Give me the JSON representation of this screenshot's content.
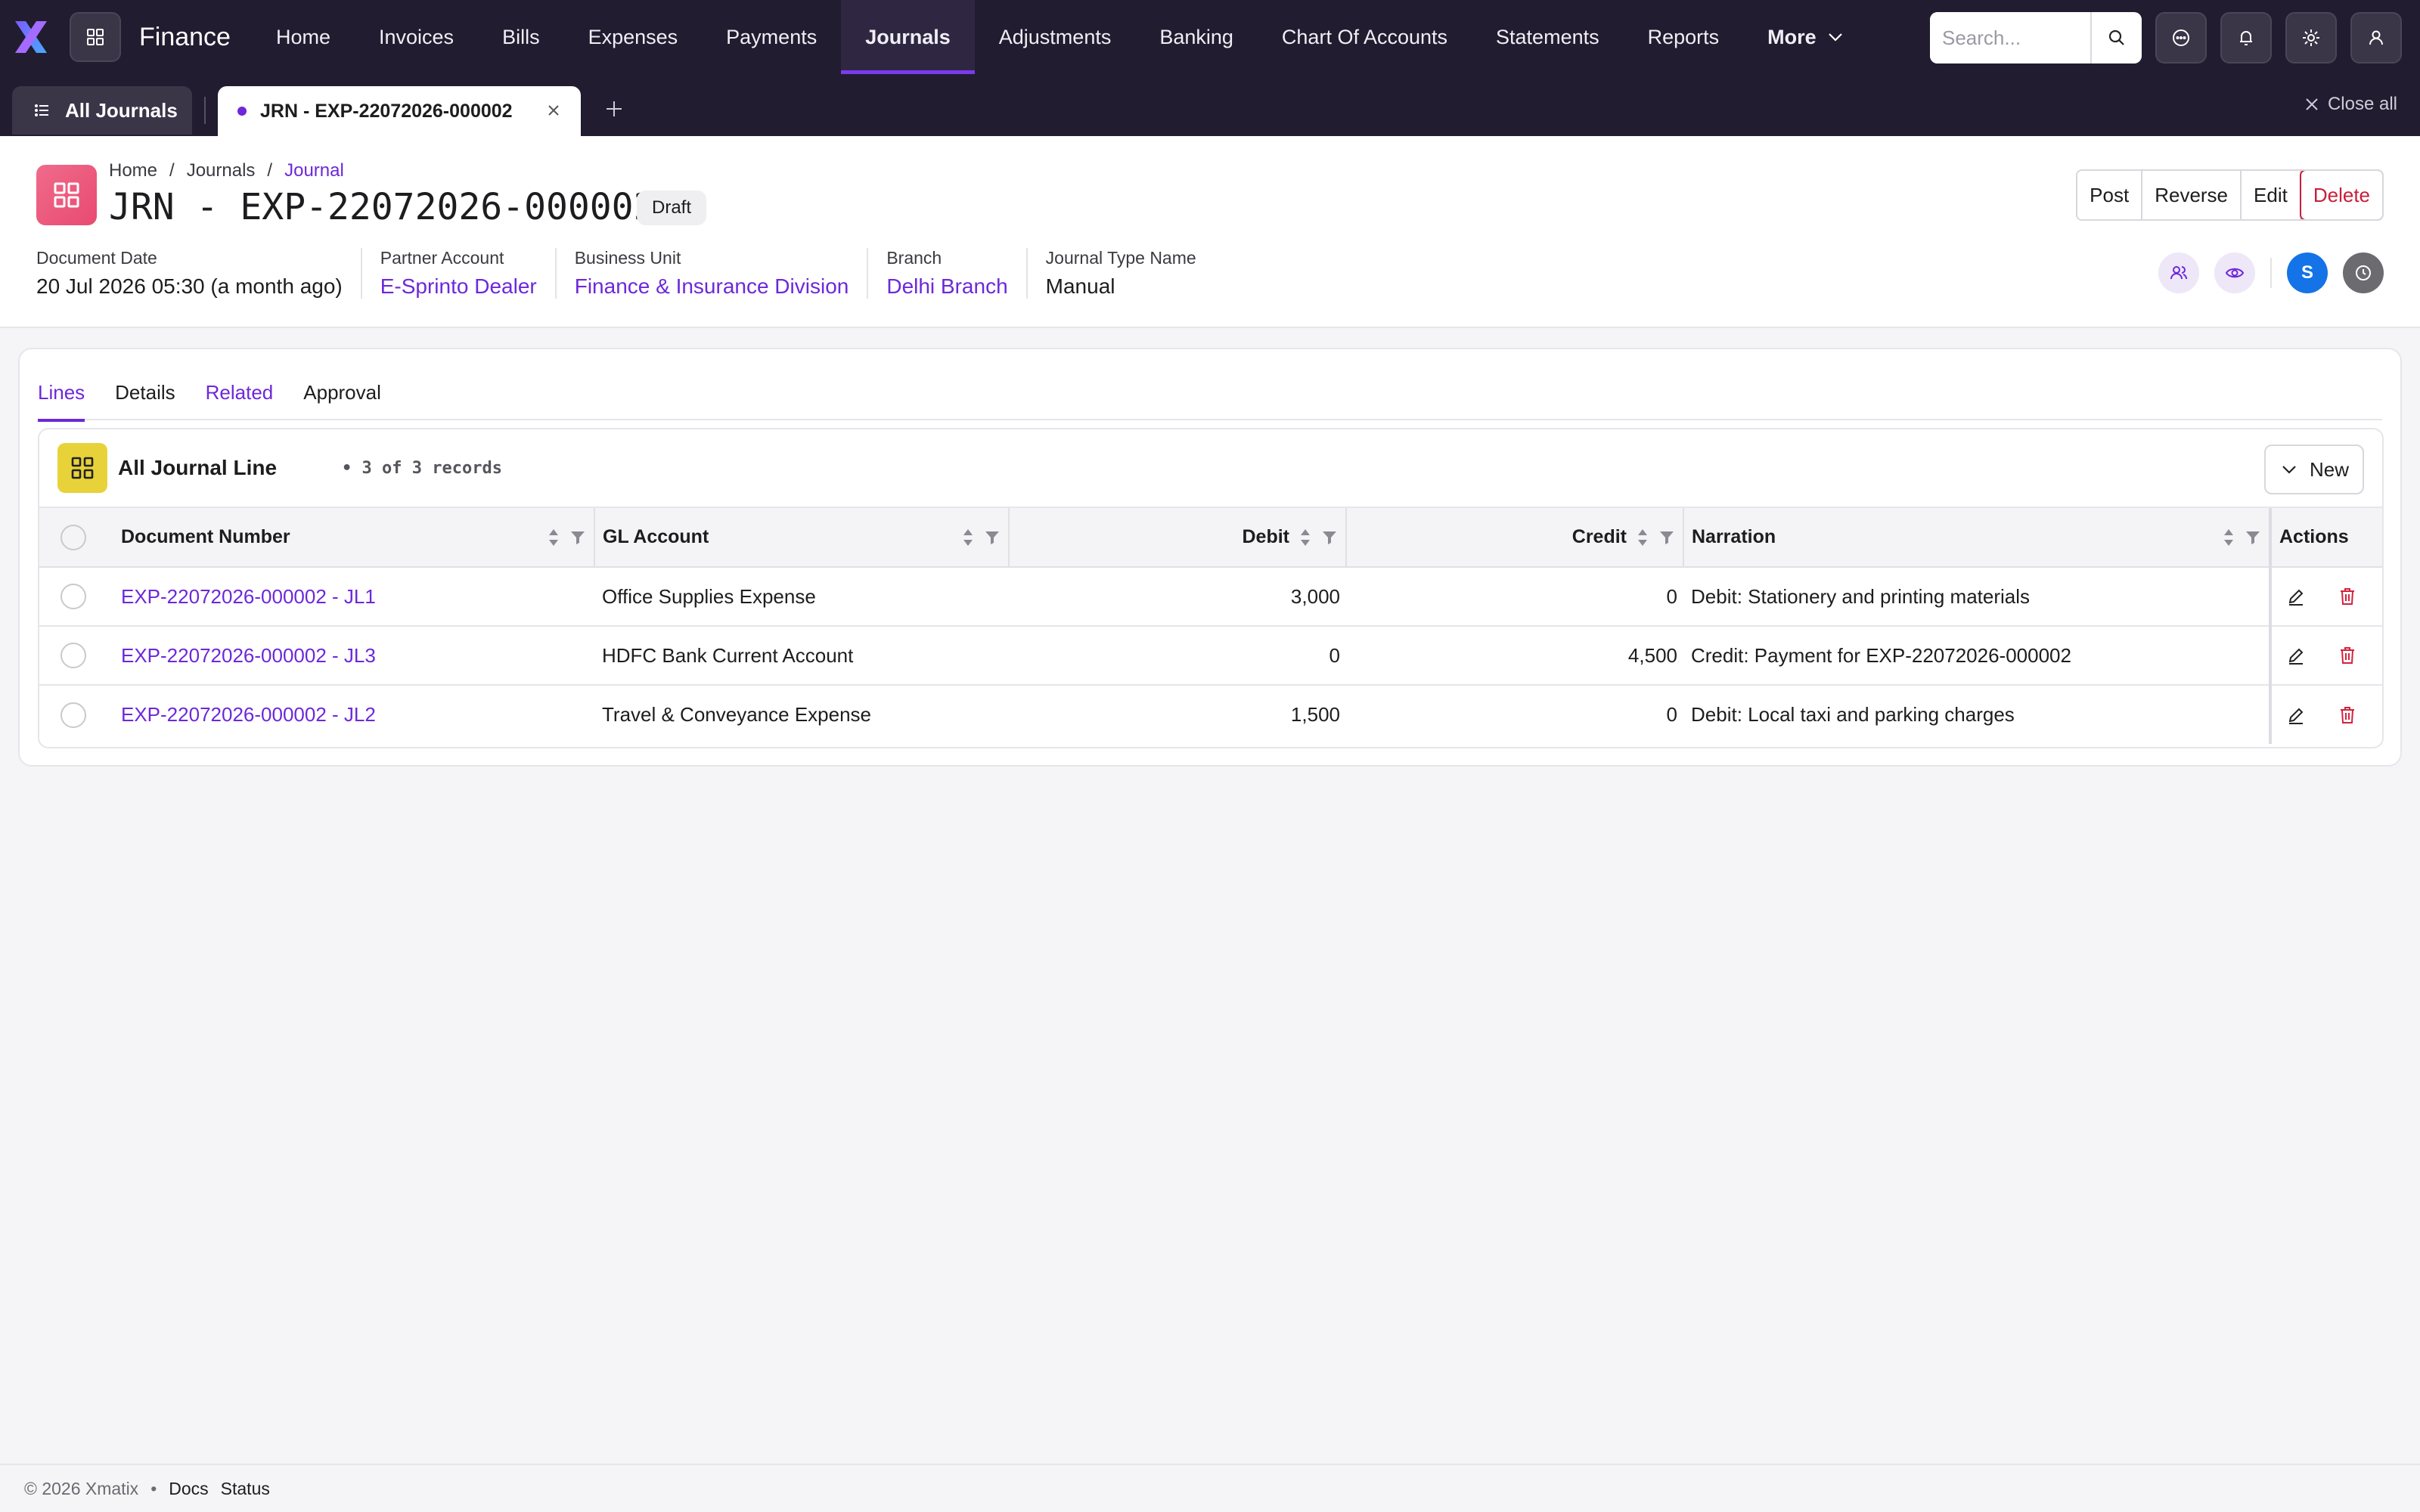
{
  "app": {
    "name": "Finance"
  },
  "nav": {
    "items": [
      {
        "label": "Home"
      },
      {
        "label": "Invoices"
      },
      {
        "label": "Bills"
      },
      {
        "label": "Expenses"
      },
      {
        "label": "Payments"
      },
      {
        "label": "Journals",
        "active": true
      },
      {
        "label": "Adjustments"
      },
      {
        "label": "Banking"
      },
      {
        "label": "Chart Of Accounts"
      },
      {
        "label": "Statements"
      },
      {
        "label": "Reports"
      }
    ],
    "more_label": "More"
  },
  "search": {
    "placeholder": "Search...",
    "value": ""
  },
  "tabs": {
    "all_label": "All Journals",
    "doc_label": "JRN - EXP-22072026-000002",
    "close_all_label": "Close all"
  },
  "header": {
    "breadcrumb": [
      "Home",
      "Journals",
      "Journal"
    ],
    "title": "JRN - EXP-22072026-000002",
    "status": "Draft",
    "actions": {
      "post": "Post",
      "reverse": "Reverse",
      "edit": "Edit",
      "delete": "Delete"
    },
    "meta": {
      "document_date_label": "Document Date",
      "document_date": "20 Jul 2026 05:30 (a month ago)",
      "partner_label": "Partner Account",
      "partner": "E-Sprinto Dealer",
      "bu_label": "Business Unit",
      "bu": "Finance & Insurance Division",
      "branch_label": "Branch",
      "branch": "Delhi Branch",
      "jtype_label": "Journal Type Name",
      "jtype": "Manual"
    },
    "avatar_initial": "S"
  },
  "subtabs": [
    "Lines",
    "Details",
    "Related",
    "Approval"
  ],
  "lines": {
    "title": "All Journal Line",
    "count": "• 3 of 3 records",
    "new_label": "New",
    "columns": [
      "Document Number",
      "GL Account",
      "Debit",
      "Credit",
      "Narration",
      "Actions"
    ],
    "rows": [
      {
        "doc": "EXP-22072026-000002 - JL1",
        "gl": "Office Supplies Expense",
        "debit": "3,000",
        "credit": "0",
        "narration": "Debit: Stationery and printing materials"
      },
      {
        "doc": "EXP-22072026-000002 - JL3",
        "gl": "HDFC Bank Current Account",
        "debit": "0",
        "credit": "4,500",
        "narration": "Credit: Payment for EXP-22072026-000002"
      },
      {
        "doc": "EXP-22072026-000002 - JL2",
        "gl": "Travel & Conveyance Expense",
        "debit": "1,500",
        "credit": "0",
        "narration": "Debit: Local taxi and parking charges"
      }
    ]
  },
  "footer": {
    "copyright": "© 2026 Xmatix",
    "docs": "Docs",
    "status": "Status"
  },
  "colors": {
    "accent": "#6d28d9",
    "topbar": "#211c2f",
    "danger": "#c81e3a"
  }
}
